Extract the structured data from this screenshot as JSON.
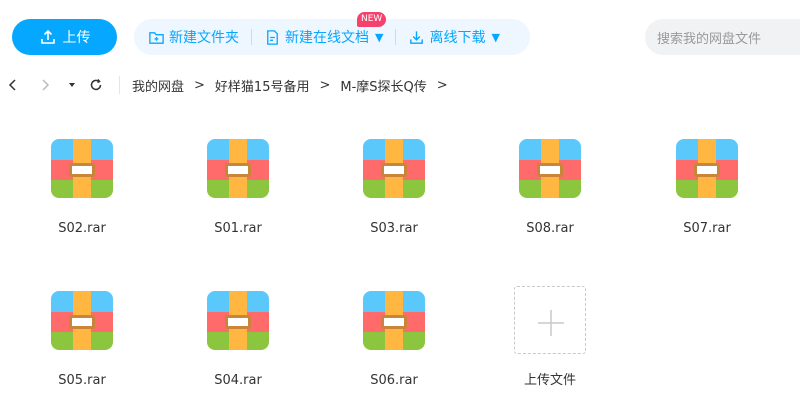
{
  "toolbar": {
    "upload_label": "上传",
    "new_folder_label": "新建文件夹",
    "new_online_doc_label": "新建在线文档",
    "new_badge": "NEW",
    "offline_download_label": "离线下载",
    "search_placeholder": "搜索我的网盘文件"
  },
  "breadcrumb": {
    "items": [
      "我的网盘",
      "好样猫15号备用",
      "M-摩S探长Q传"
    ],
    "separator": ">"
  },
  "files": [
    {
      "name": "S02.rar",
      "icon": "rar-archive-icon"
    },
    {
      "name": "S01.rar",
      "icon": "rar-archive-icon"
    },
    {
      "name": "S03.rar",
      "icon": "rar-archive-icon"
    },
    {
      "name": "S08.rar",
      "icon": "rar-archive-icon"
    },
    {
      "name": "S07.rar",
      "icon": "rar-archive-icon"
    },
    {
      "name": "S05.rar",
      "icon": "rar-archive-icon"
    },
    {
      "name": "S04.rar",
      "icon": "rar-archive-icon"
    },
    {
      "name": "S06.rar",
      "icon": "rar-archive-icon"
    }
  ],
  "upload_tile_label": "上传文件",
  "colors": {
    "accent": "#06a7ff",
    "badge": "#f5426c",
    "rar_top": "#5ac8fa",
    "rar_middle": "#ff6b6b",
    "rar_bottom": "#8cc63f",
    "rar_strap": "#ffb742"
  }
}
